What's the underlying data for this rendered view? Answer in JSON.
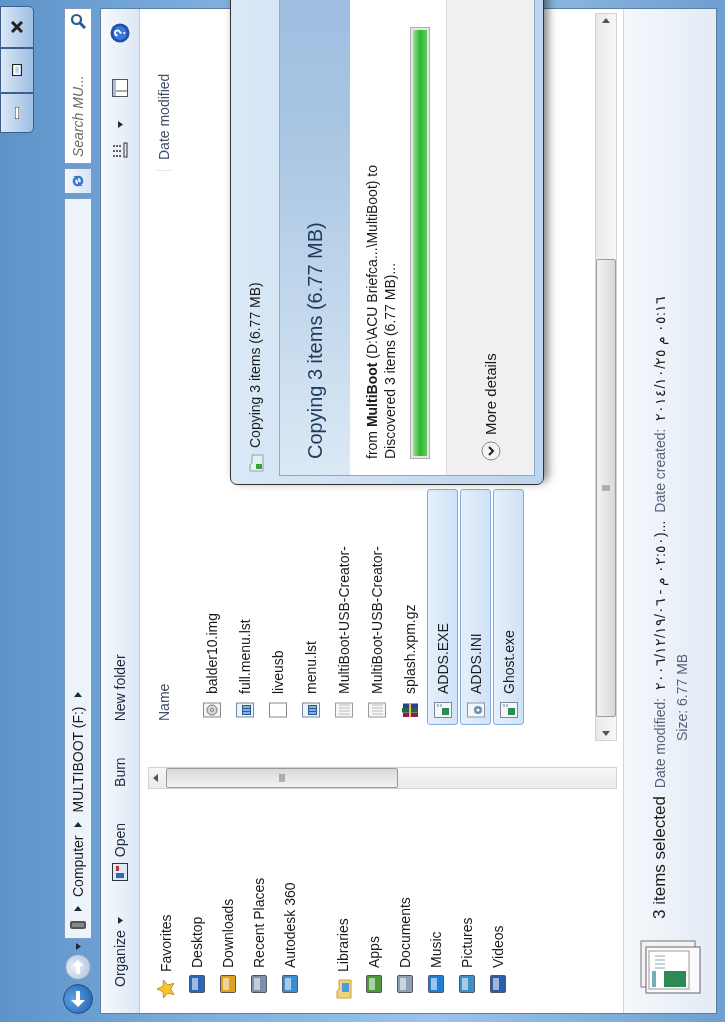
{
  "address_bar": {
    "crumbs": [
      "Computer",
      "MULTIBOOT (F:)"
    ]
  },
  "search": {
    "placeholder": "Search MU..."
  },
  "toolbar": {
    "buttons": [
      {
        "label": "Organize",
        "kind": "menu"
      },
      {
        "label": "Open",
        "kind": "open"
      },
      {
        "label": "Burn",
        "kind": "plain"
      },
      {
        "label": "New folder",
        "kind": "plain"
      }
    ]
  },
  "nav_pane": {
    "groups": [
      {
        "label": "Favorites",
        "kind": "favorites",
        "items": [
          "Desktop",
          "Downloads",
          "Recent Places",
          "Autodesk 360"
        ]
      },
      {
        "label": "Libraries",
        "kind": "libraries",
        "items": [
          "Apps",
          "Documents",
          "Music",
          "Pictures",
          "Videos"
        ]
      }
    ]
  },
  "file_list": {
    "columns": [
      "Name",
      "Date modified"
    ],
    "rows": [
      {
        "name": "balder10.img",
        "kind": "disc",
        "selected": false
      },
      {
        "name": "full.menu.lst",
        "kind": "text",
        "selected": false
      },
      {
        "name": "liveusb",
        "kind": "blank",
        "selected": false
      },
      {
        "name": "menu.lst",
        "kind": "text",
        "selected": false
      },
      {
        "name": "MultiBoot-USB-Creator-",
        "kind": "doc",
        "selected": false
      },
      {
        "name": "MultiBoot-USB-Creator-",
        "kind": "doc",
        "selected": false
      },
      {
        "name": "splash.xpm.gz",
        "kind": "archive",
        "selected": false
      },
      {
        "name": "ADDS.EXE",
        "kind": "exe",
        "selected": true
      },
      {
        "name": "ADDS.INI",
        "kind": "config",
        "selected": true
      },
      {
        "name": "Ghost.exe",
        "kind": "exe",
        "selected": true
      }
    ]
  },
  "details": {
    "count": "3 items selected",
    "modified_label": "Date modified:",
    "modified_value": "٢٠٠٦/١٢/١٩/٠٦ - م ٠٢:٥٠)...",
    "created_label": "Date created:",
    "created_value": "٢٠١٤/١٠/٢٥ م ٠٥:١٦",
    "size": "Size: 6.77 MB"
  },
  "dialog": {
    "title": "Copying 3 items (6.77 MB)",
    "heading": "Copying 3 items (6.77 MB)",
    "from_line": "from **MultiBoot** (D:\\ACU Briefca...\\MultiBoot) to",
    "status": "Discovered 3 items (6.77 MB)...",
    "progress": {
      "level": 1
    },
    "more_details": "More details"
  }
}
